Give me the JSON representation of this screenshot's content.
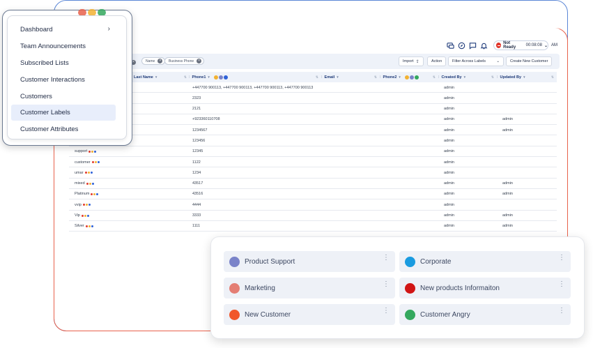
{
  "topbar": {
    "status": "Not Ready",
    "time": "00:08:08",
    "ampm": "AM",
    "icons": [
      "chat-icon",
      "compass-icon",
      "message-icon",
      "bell-icon"
    ]
  },
  "filterbar": {
    "chips": [
      "Name",
      "Business Phone"
    ],
    "import_label": "Import",
    "action_label": "Action",
    "filter_label": "Filter Across Labels",
    "create_label": "Create New Customer"
  },
  "table": {
    "columns": [
      "Last Name",
      "Phone1",
      "Email",
      "Phone2",
      "Created By",
      "Updated By"
    ],
    "rows": [
      {
        "first": "",
        "phone1": "+447700 900113, +447700 900113, +447700 900113, +447700 900113",
        "created": "admin",
        "updated": ""
      },
      {
        "first": "",
        "phone1": "2323",
        "created": "admin",
        "updated": ""
      },
      {
        "first": "",
        "phone1": "2121",
        "created": "admin",
        "updated": ""
      },
      {
        "first": "",
        "phone1": "+923360110708",
        "created": "admin",
        "updated": "admin"
      },
      {
        "first": "",
        "phone1": "1234567",
        "created": "admin",
        "updated": "admin"
      },
      {
        "first": "",
        "phone1": "123456",
        "created": "admin",
        "updated": ""
      },
      {
        "first": "support",
        "phone1": "12345",
        "created": "admin",
        "updated": ""
      },
      {
        "first": "customer",
        "phone1": "1122",
        "created": "admin",
        "updated": ""
      },
      {
        "first": "umar",
        "phone1": "1234",
        "created": "admin",
        "updated": ""
      },
      {
        "first": "mixed",
        "phone1": "43517",
        "created": "admin",
        "updated": "admin"
      },
      {
        "first": "Platinum",
        "phone1": "43516",
        "created": "admin",
        "updated": "admin"
      },
      {
        "first": "vvip",
        "phone1": "4444",
        "created": "admin",
        "updated": ""
      },
      {
        "first": "Vip",
        "phone1": "3333",
        "created": "admin",
        "updated": "admin"
      },
      {
        "first": "Silver",
        "phone1": "1111",
        "created": "admin",
        "updated": "admin"
      }
    ],
    "tag_colors": [
      "#e23b2e",
      "#f2b233",
      "#2f62d8"
    ]
  },
  "menu": {
    "items": [
      {
        "label": "Dashboard",
        "has_chevron": true
      },
      {
        "label": "Team Announcements"
      },
      {
        "label": "Subscribed Lists"
      },
      {
        "label": "Customer Interactions"
      },
      {
        "label": "Customers"
      },
      {
        "label": "Customer Labels",
        "active": true
      },
      {
        "label": "Customer Attributes"
      }
    ],
    "chevron": "›"
  },
  "labels": [
    {
      "name": "Product Support",
      "color": "#7a83c9"
    },
    {
      "name": "Corporate",
      "color": "#1a9be0"
    },
    {
      "name": "Marketing",
      "color": "#e47e74"
    },
    {
      "name": "New products Informaiton",
      "color": "#d11515"
    },
    {
      "name": "New Customer",
      "color": "#f1572a"
    },
    {
      "name": "Customer Angry",
      "color": "#34a85e"
    }
  ]
}
